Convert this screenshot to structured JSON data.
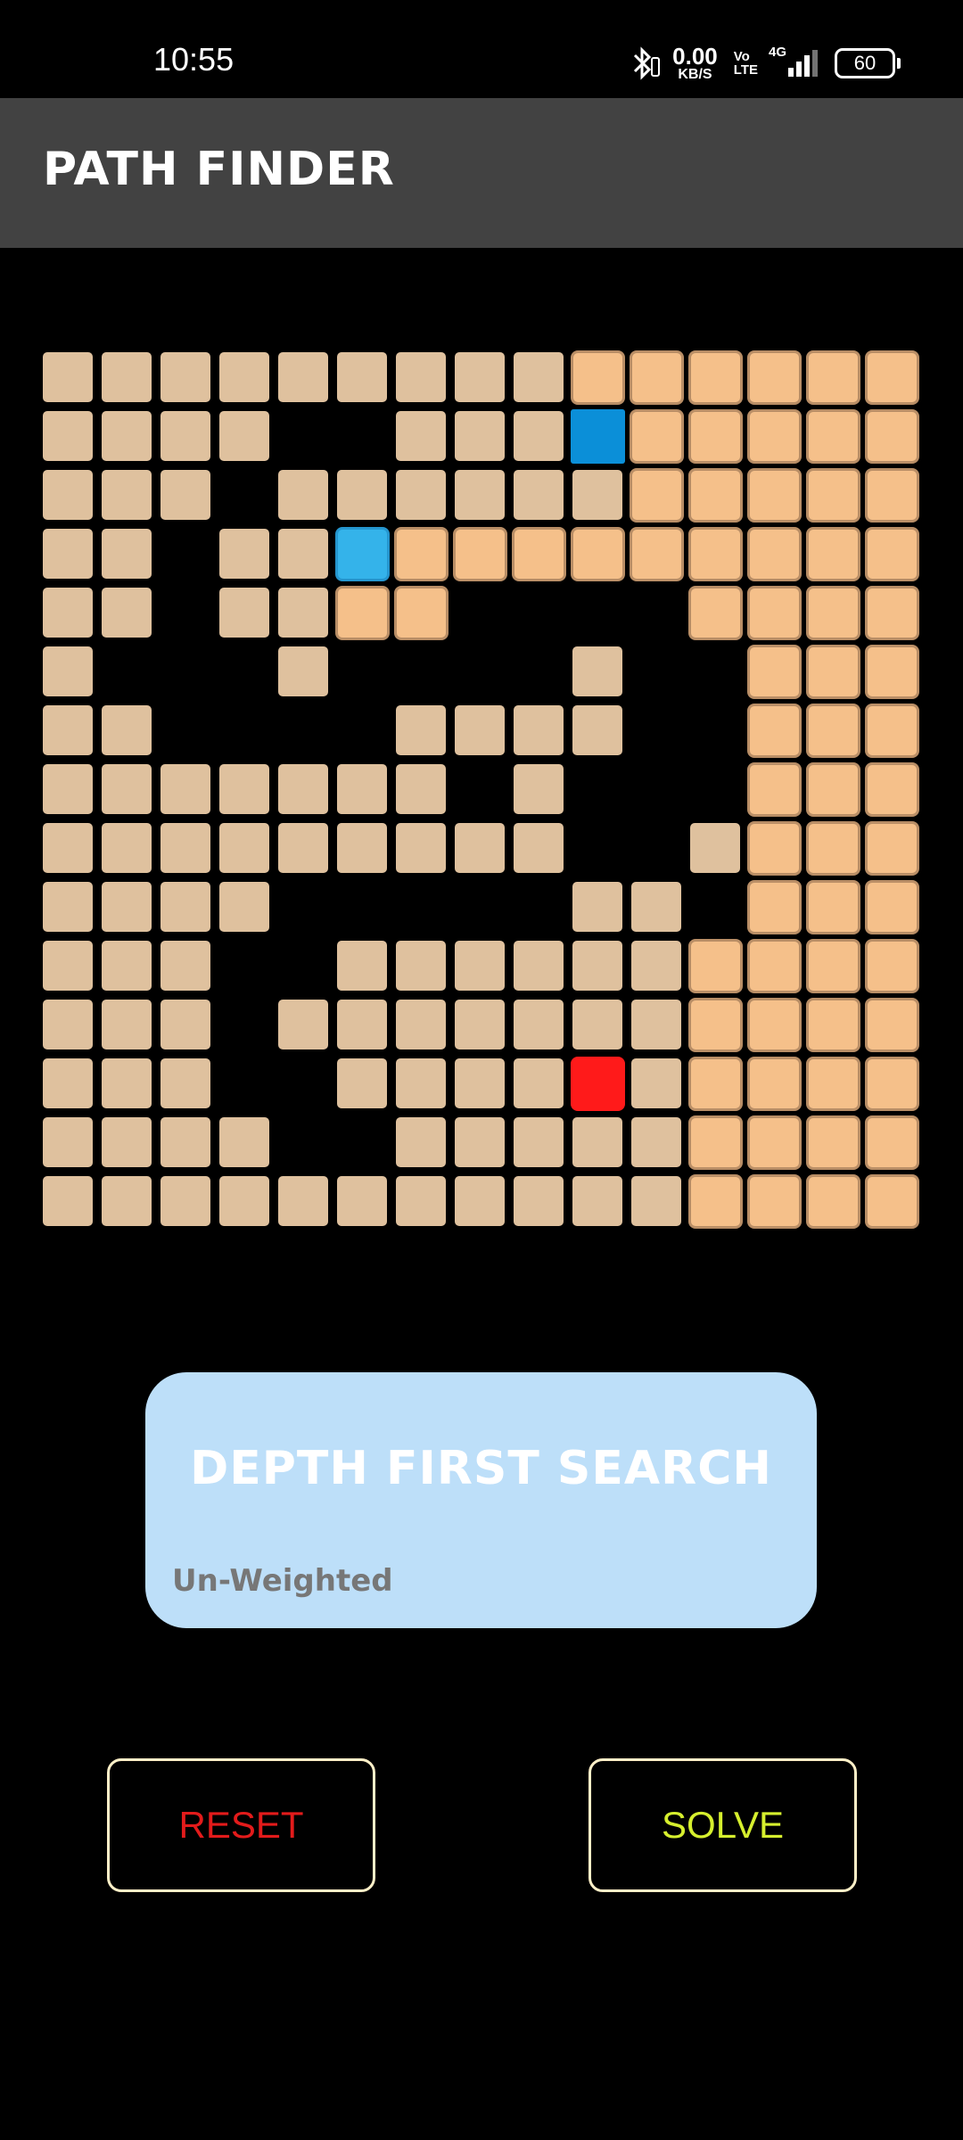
{
  "status_bar": {
    "time": "10:55",
    "speed_value": "0.00",
    "speed_unit": "KB/S",
    "volte_top": "Vo",
    "volte_bottom": "LTE",
    "network": "4G",
    "battery": "60"
  },
  "app_bar": {
    "title": "PATH FINDER"
  },
  "grid": {
    "rows": 15,
    "cols": 15,
    "cells": [
      "OOOOOOOOOVVVVVV",
      "OOOO..OOOSVVVVV",
      "OOO.OOOOOOVVVVV",
      "OO.OOPVVVVVVVVV",
      "OO.OOVV....VVVV",
      "O...O....O..VVVV",
      "OO....OOOO..VVVV",
      "OOOOOOO.O...VVVV",
      "OOOOOOOOO..OVVVV",
      "OOOO.....OO.VVVV",
      "OOO..OOOOOOVVVV",
      "OOO.OOOOOOOVVVV",
      "OOO..OOOOEOVVVV",
      "OOOO..OOOOOVVVV",
      "OOOOOOOOOOOVVVV"
    ],
    "legend": {
      "O": "open",
      "V": "visited",
      "P": "path",
      "S": "start",
      "E": "end",
      ".": "wall"
    },
    "colors": {
      "open": "#dfc19e",
      "visited": "#f5c08a",
      "path": "#34b3ea",
      "start": "#0b8fd8",
      "end": "#ff1a1a"
    }
  },
  "algorithm_card": {
    "title": "DEPTH FIRST SEARCH",
    "type_label": "Un-Weighted"
  },
  "controls": {
    "reset_label": "RESET",
    "solve_label": "SOLVE"
  }
}
